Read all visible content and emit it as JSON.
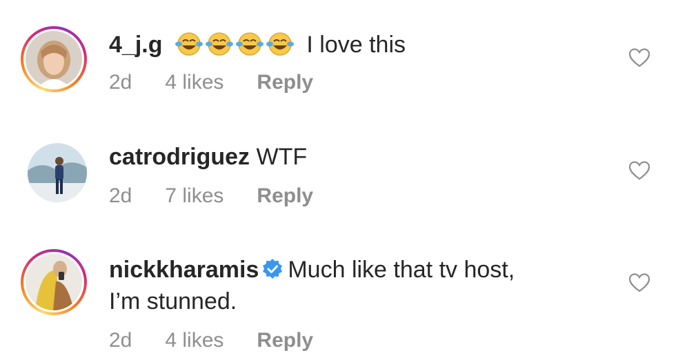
{
  "comments": [
    {
      "username": "4_j.g",
      "emojis": [
        "face-with-tears-of-joy-icon",
        "face-with-tears-of-joy-icon",
        "face-with-tears-of-joy-icon",
        "face-with-tears-of-joy-icon"
      ],
      "text": "I love this",
      "time": "2d",
      "likes": "4 likes",
      "reply": "Reply"
    },
    {
      "username": "catrodriguez",
      "text": "WTF",
      "time": "2d",
      "likes": "7 likes",
      "reply": "Reply"
    },
    {
      "username": "nickkharamis",
      "verified": true,
      "text": "Much like that tv host,",
      "text_cont": "I’m stunned.",
      "time": "2d",
      "likes": "4 likes",
      "reply": "Reply"
    }
  ],
  "colors": {
    "text": "#262626",
    "meta": "#8e8e8e",
    "verified_blue": "#3897f0",
    "story_ring": [
      "#feda75",
      "#fa7e1e",
      "#d62976",
      "#962fbf"
    ]
  }
}
